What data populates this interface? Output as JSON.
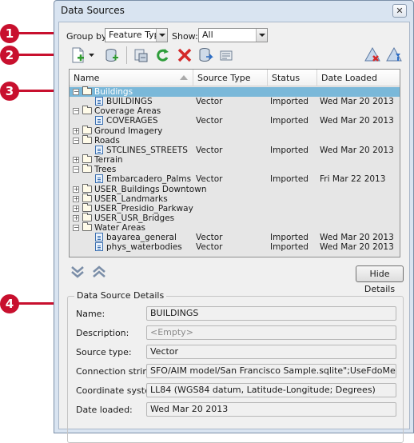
{
  "window": {
    "title": "Data Sources",
    "close_symbol": "✕"
  },
  "callouts": [
    "1",
    "2",
    "3",
    "4"
  ],
  "filter": {
    "group_by_label": "Group by:",
    "group_by_value": "Feature Type",
    "show_label": "Show:",
    "show_value": "All"
  },
  "toolbar": {
    "icons": [
      "new-data-source-icon",
      "dropdown-arrow-icon",
      "connect-database-icon",
      "refresh-cache-icon",
      "refresh-icon",
      "delete-icon",
      "export-icon",
      "properties-icon",
      "remove-sources-icon",
      "add-sources-icon"
    ]
  },
  "list": {
    "columns": [
      "Name",
      "Source Type",
      "Status",
      "Date Loaded"
    ],
    "rows": [
      {
        "name": "Buildings",
        "type": "",
        "status": "",
        "date": "",
        "kind": "folder",
        "level": 0,
        "expander": "−",
        "selected": true
      },
      {
        "name": "BUILDINGS",
        "type": "Vector",
        "status": "Imported",
        "date": "Wed Mar 20 2013",
        "kind": "doc",
        "level": 1,
        "expander": "",
        "selected": false
      },
      {
        "name": "Coverage Areas",
        "type": "",
        "status": "",
        "date": "",
        "kind": "folder",
        "level": 0,
        "expander": "−",
        "selected": false
      },
      {
        "name": "COVERAGES",
        "type": "Vector",
        "status": "Imported",
        "date": "Wed Mar 20 2013",
        "kind": "doc",
        "level": 1,
        "expander": "",
        "selected": false
      },
      {
        "name": "Ground Imagery",
        "type": "",
        "status": "",
        "date": "",
        "kind": "folder",
        "level": 0,
        "expander": "+",
        "selected": false
      },
      {
        "name": "Roads",
        "type": "",
        "status": "",
        "date": "",
        "kind": "folder",
        "level": 0,
        "expander": "−",
        "selected": false
      },
      {
        "name": "STCLINES_STREETS",
        "type": "Vector",
        "status": "Imported",
        "date": "Wed Mar 20 2013",
        "kind": "doc",
        "level": 1,
        "expander": "",
        "selected": false
      },
      {
        "name": "Terrain",
        "type": "",
        "status": "",
        "date": "",
        "kind": "folder",
        "level": 0,
        "expander": "+",
        "selected": false
      },
      {
        "name": "Trees",
        "type": "",
        "status": "",
        "date": "",
        "kind": "folder",
        "level": 0,
        "expander": "−",
        "selected": false
      },
      {
        "name": "Embarcadero_Palms",
        "type": "Vector",
        "status": "Imported",
        "date": "Fri Mar 22 2013",
        "kind": "doc",
        "level": 1,
        "expander": "",
        "selected": false
      },
      {
        "name": "USER_Buildings Downtown",
        "type": "",
        "status": "",
        "date": "",
        "kind": "folder",
        "level": 0,
        "expander": "+",
        "selected": false
      },
      {
        "name": "USER_Landmarks",
        "type": "",
        "status": "",
        "date": "",
        "kind": "folder",
        "level": 0,
        "expander": "+",
        "selected": false
      },
      {
        "name": "USER_Presidio_Parkway",
        "type": "",
        "status": "",
        "date": "",
        "kind": "folder",
        "level": 0,
        "expander": "+",
        "selected": false
      },
      {
        "name": "USER_USR_Bridges",
        "type": "",
        "status": "",
        "date": "",
        "kind": "folder",
        "level": 0,
        "expander": "+",
        "selected": false
      },
      {
        "name": "Water Areas",
        "type": "",
        "status": "",
        "date": "",
        "kind": "folder",
        "level": 0,
        "expander": "−",
        "selected": false
      },
      {
        "name": "bayarea_general",
        "type": "Vector",
        "status": "Imported",
        "date": "Wed Mar 20 2013",
        "kind": "doc",
        "level": 1,
        "expander": "",
        "selected": false
      },
      {
        "name": "phys_waterbodies",
        "type": "Vector",
        "status": "Imported",
        "date": "Wed Mar 20 2013",
        "kind": "doc",
        "level": 1,
        "expander": "",
        "selected": false
      }
    ]
  },
  "actions": {
    "hide_details": "Hide Details"
  },
  "details": {
    "title": "Data Source Details",
    "fields": [
      {
        "label": "Name:",
        "value": "BUILDINGS",
        "empty": false
      },
      {
        "label": "Description:",
        "value": "<Empty>",
        "empty": true
      },
      {
        "label": "Source type:",
        "value": "Vector",
        "empty": false
      },
      {
        "label": "Connection string:",
        "value": "SFO/AIM model/San Francisco Sample.sqlite\";UseFdoMetadata=TRUE",
        "empty": false
      },
      {
        "label": "Coordinate system:",
        "value": "LL84 (WGS84 datum, Latitude-Longitude; Degrees)",
        "empty": false
      },
      {
        "label": "Date loaded:",
        "value": "Wed Mar 20 2013",
        "empty": false
      }
    ]
  },
  "colors": {
    "callout": "#c8102e",
    "selection": "#7ab8d9",
    "window": "#d9e4f1",
    "panel": "#f0f0f0"
  }
}
